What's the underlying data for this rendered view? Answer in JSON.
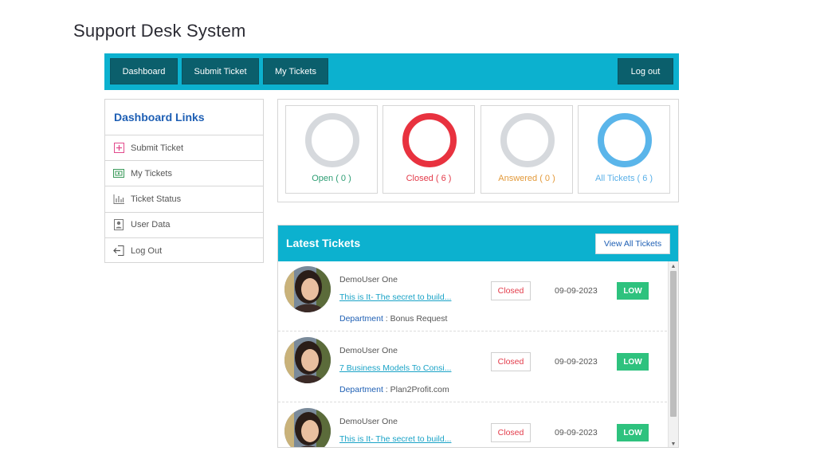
{
  "page": {
    "title": "Support Desk System"
  },
  "nav": {
    "dashboard": "Dashboard",
    "submit_ticket": "Submit Ticket",
    "my_tickets": "My Tickets",
    "logout": "Log out"
  },
  "sidebar": {
    "heading": "Dashboard Links",
    "items": [
      {
        "label": "Submit Ticket",
        "icon": "plus-square-icon"
      },
      {
        "label": "My Tickets",
        "icon": "ticket-icon"
      },
      {
        "label": "Ticket Status",
        "icon": "bar-chart-icon"
      },
      {
        "label": "User Data",
        "icon": "user-card-icon"
      },
      {
        "label": "Log Out",
        "icon": "logout-icon"
      }
    ]
  },
  "stats": [
    {
      "label": "Open ( 0 )",
      "color": "#2e9e74",
      "ring": "#d6d9dd"
    },
    {
      "label": "Closed ( 6 )",
      "color": "#e33b4a",
      "ring": "#e8323f"
    },
    {
      "label": "Answered ( 0 )",
      "color": "#e39a3b",
      "ring": "#d6d9dd"
    },
    {
      "label": "All Tickets ( 6 )",
      "color": "#5ab0e8",
      "ring": "#5ab5ea"
    }
  ],
  "latest": {
    "title": "Latest Tickets",
    "view_all": "View All Tickets",
    "dept_label": "Department",
    "tickets": [
      {
        "user": "DemoUser One",
        "subject": "This is It- The secret to build...",
        "department": "Bonus Request",
        "status": "Closed",
        "date": "09-09-2023",
        "priority": "LOW"
      },
      {
        "user": "DemoUser One",
        "subject": "7 Business Models To Consi...",
        "department": "Plan2Profit.com",
        "status": "Closed",
        "date": "09-09-2023",
        "priority": "LOW"
      },
      {
        "user": "DemoUser One",
        "subject": "This is It- The secret to build...",
        "department": "",
        "status": "Closed",
        "date": "09-09-2023",
        "priority": "LOW"
      }
    ]
  },
  "colors": {
    "accent": "#0cb1cf",
    "nav_button": "#0b5f6c",
    "low_priority": "#2ec27e",
    "closed": "#e33b4a"
  }
}
